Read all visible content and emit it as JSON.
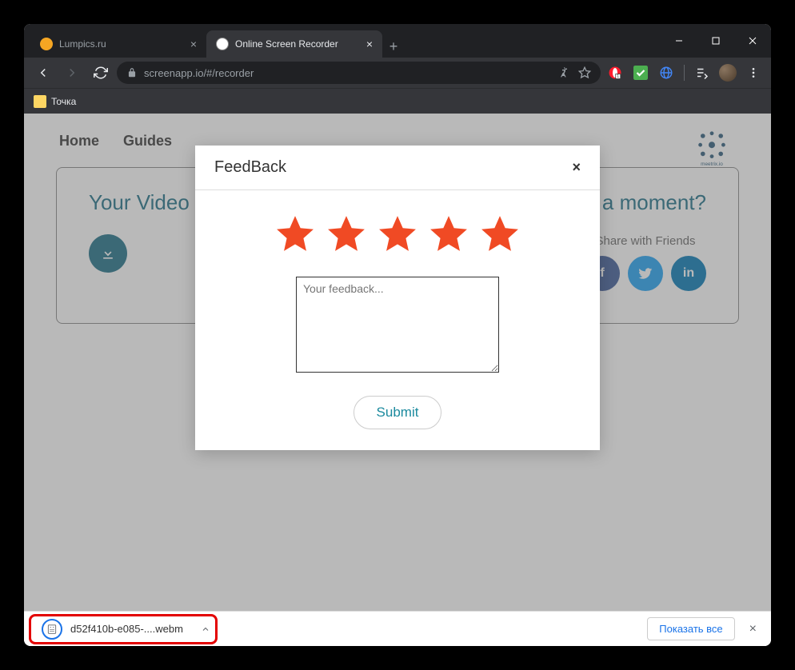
{
  "browser": {
    "tabs": [
      {
        "title": "Lumpics.ru",
        "favicon_color": "#f5a623",
        "active": false
      },
      {
        "title": "Online Screen Recorder",
        "favicon_color": "#ffffff",
        "active": true
      }
    ],
    "url": "screenapp.io/#/recorder",
    "bookmark": "Точка"
  },
  "page": {
    "nav": [
      "Home",
      "Guides"
    ],
    "title_left": "Your Video is re",
    "title_right": "ve a moment?",
    "share_label": "Share with Friends",
    "logo_label": "meetrix.io"
  },
  "modal": {
    "title": "FeedBack",
    "placeholder": "Your feedback...",
    "submit": "Submit",
    "star_count": 5
  },
  "downloads": {
    "filename": "d52f410b-e085-....webm",
    "show_all": "Показать все"
  },
  "colors": {
    "star": "#f04a24",
    "fb": "#3b5998",
    "tw": "#1da1f2",
    "li": "#0077b5",
    "accent": "#1b6d85"
  }
}
